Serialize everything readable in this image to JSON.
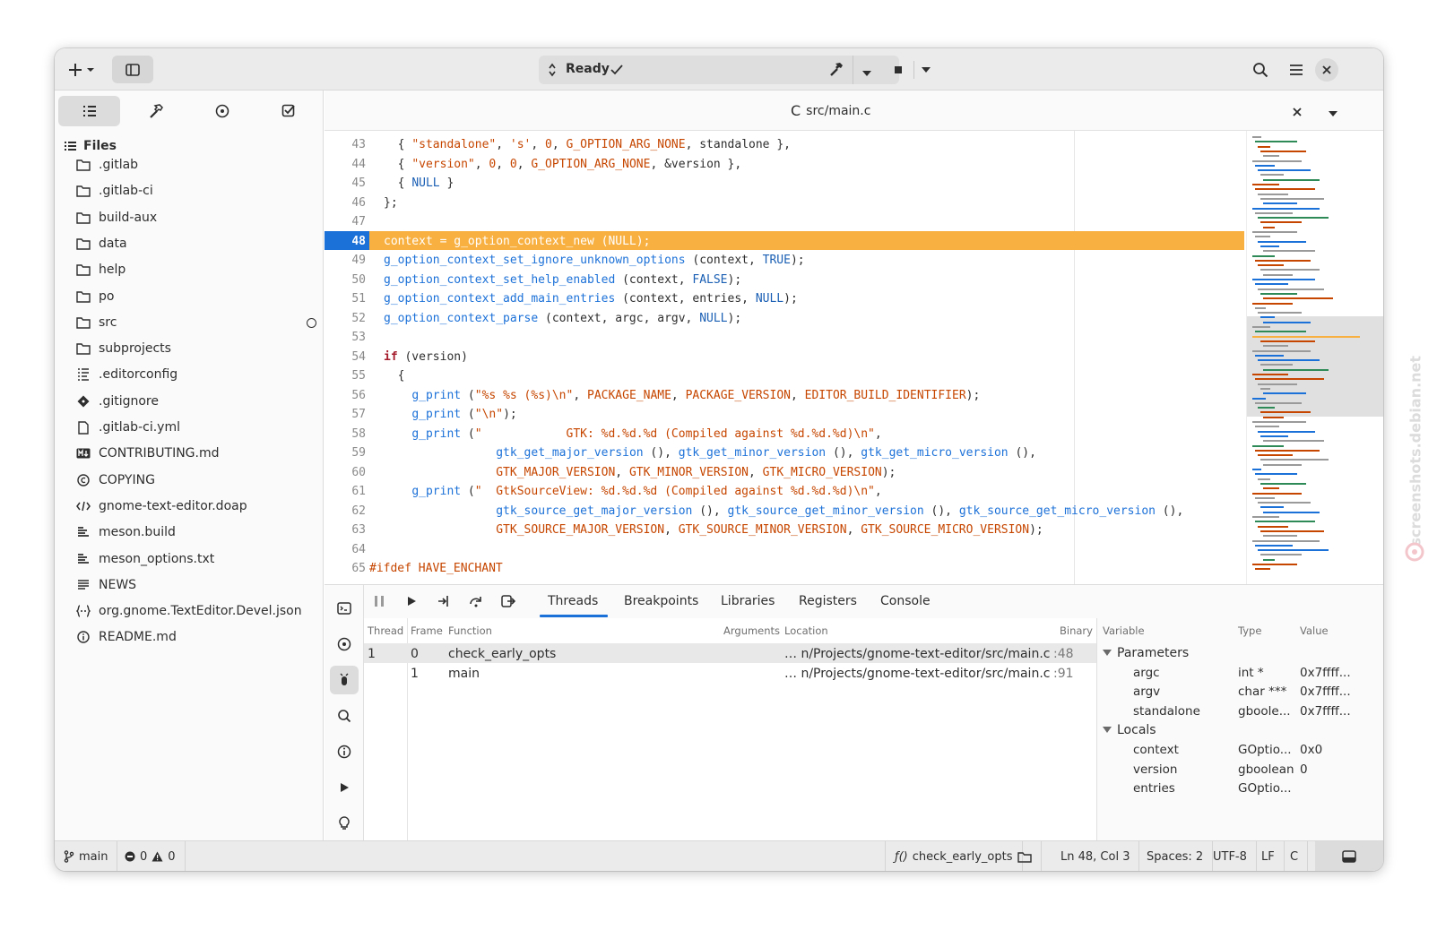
{
  "header": {
    "status": "Ready",
    "new_label": "+"
  },
  "sidebar": {
    "title": "Files",
    "items": [
      {
        "label": ".gitlab",
        "icon": "folder-icon"
      },
      {
        "label": ".gitlab-ci",
        "icon": "folder-icon"
      },
      {
        "label": "build-aux",
        "icon": "folder-icon"
      },
      {
        "label": "data",
        "icon": "folder-icon"
      },
      {
        "label": "help",
        "icon": "folder-icon"
      },
      {
        "label": "po",
        "icon": "folder-icon"
      },
      {
        "label": "src",
        "icon": "folder-icon"
      },
      {
        "label": "subprojects",
        "icon": "folder-icon"
      },
      {
        "label": ".editorconfig",
        "icon": "config-file-icon"
      },
      {
        "label": ".gitignore",
        "icon": "git-icon"
      },
      {
        "label": ".gitlab-ci.yml",
        "icon": "file-icon"
      },
      {
        "label": "CONTRIBUTING.md",
        "icon": "markdown-icon"
      },
      {
        "label": "COPYING",
        "icon": "copyright-icon"
      },
      {
        "label": "gnome-text-editor.doap",
        "icon": "code-icon"
      },
      {
        "label": "meson.build",
        "icon": "build-icon"
      },
      {
        "label": "meson_options.txt",
        "icon": "build-icon"
      },
      {
        "label": "NEWS",
        "icon": "text-icon"
      },
      {
        "label": "org.gnome.TextEditor.Devel.json",
        "icon": "json-icon"
      },
      {
        "label": "README.md",
        "icon": "info-icon"
      }
    ]
  },
  "editor": {
    "tab_title": "src/main.c",
    "tab_lang_icon": "C",
    "current_line": "48",
    "lines": [
      {
        "n": "43",
        "t": "  { \"standalone\", 's', 0, G_OPTION_ARG_NONE, standalone },"
      },
      {
        "n": "44",
        "t": "  { \"version\", 0, 0, G_OPTION_ARG_NONE, &version },"
      },
      {
        "n": "45",
        "t": "  { NULL }"
      },
      {
        "n": "46",
        "t": "};"
      },
      {
        "n": "47",
        "t": ""
      },
      {
        "n": "48",
        "t": "context = g_option_context_new (NULL);"
      },
      {
        "n": "49",
        "t": "g_option_context_set_ignore_unknown_options (context, TRUE);"
      },
      {
        "n": "50",
        "t": "g_option_context_set_help_enabled (context, FALSE);"
      },
      {
        "n": "51",
        "t": "g_option_context_add_main_entries (context, entries, NULL);"
      },
      {
        "n": "52",
        "t": "g_option_context_parse (context, argc, argv, NULL);"
      },
      {
        "n": "53",
        "t": ""
      },
      {
        "n": "54",
        "t": "if (version)"
      },
      {
        "n": "55",
        "t": "  {"
      },
      {
        "n": "56",
        "t": "    g_print (\"%s %s (%s)\\n\", PACKAGE_NAME, PACKAGE_VERSION, EDITOR_BUILD_IDENTIFIER);"
      },
      {
        "n": "57",
        "t": "    g_print (\"\\n\");"
      },
      {
        "n": "58",
        "t": "    g_print (\"            GTK: %d.%d.%d (Compiled against %d.%d.%d)\\n\","
      },
      {
        "n": "59",
        "t": "                gtk_get_major_version (), gtk_get_minor_version (), gtk_get_micro_version (),"
      },
      {
        "n": "60",
        "t": "                GTK_MAJOR_VERSION, GTK_MINOR_VERSION, GTK_MICRO_VERSION);"
      },
      {
        "n": "61",
        "t": "    g_print (\"  GtkSourceView: %d.%d.%d (Compiled against %d.%d.%d)\\n\","
      },
      {
        "n": "62",
        "t": "                gtk_source_get_major_version (), gtk_source_get_minor_version (), gtk_source_get_micro_version (),"
      },
      {
        "n": "63",
        "t": "                GTK_SOURCE_MAJOR_VERSION, GTK_SOURCE_MINOR_VERSION, GTK_SOURCE_MICRO_VERSION);"
      },
      {
        "n": "64",
        "t": ""
      },
      {
        "n": "65",
        "t": "#ifdef HAVE_ENCHANT"
      }
    ]
  },
  "panel": {
    "tabs": [
      "Threads",
      "Breakpoints",
      "Libraries",
      "Registers",
      "Console"
    ],
    "active_tab": "Threads",
    "columns": [
      "Thread",
      "Frame",
      "Function",
      "Arguments",
      "Location",
      "Binary"
    ],
    "rows": [
      {
        "thread": "1",
        "frame": "0",
        "function": "check_early_opts",
        "location": "… n/Projects/gnome-text-editor/src/main.c",
        "line": ":48"
      },
      {
        "thread": "",
        "frame": "1",
        "function": "main",
        "location": "… n/Projects/gnome-text-editor/src/main.c",
        "line": ":91"
      }
    ],
    "var_columns": [
      "Variable",
      "Type",
      "Value"
    ],
    "groups": [
      {
        "name": "Parameters",
        "vars": [
          {
            "name": "argc",
            "type": "int *",
            "value": "0x7ffff..."
          },
          {
            "name": "argv",
            "type": "char ***",
            "value": "0x7ffff..."
          },
          {
            "name": "standalone",
            "type": "gboole...",
            "value": "0x7ffff..."
          }
        ]
      },
      {
        "name": "Locals",
        "vars": [
          {
            "name": "context",
            "type": "GOptio...",
            "value": "0x0"
          },
          {
            "name": "version",
            "type": "gboolean",
            "value": "0"
          },
          {
            "name": "entries",
            "type": "GOptio...",
            "value": ""
          }
        ]
      }
    ]
  },
  "statusbar": {
    "branch": "main",
    "errors": "0",
    "warnings": "0",
    "symbol": "check_early_opts",
    "position": "Ln 48, Col 3",
    "indent": "Spaces: 2",
    "encoding": "UTF-8",
    "line_ending": "LF",
    "language": "C"
  },
  "watermark": "screenshots.debian.net",
  "colors": {
    "accent": "#1c71d8",
    "current_line": "#f8b040",
    "string": "#c64600",
    "keyword": "#a51d2d"
  }
}
